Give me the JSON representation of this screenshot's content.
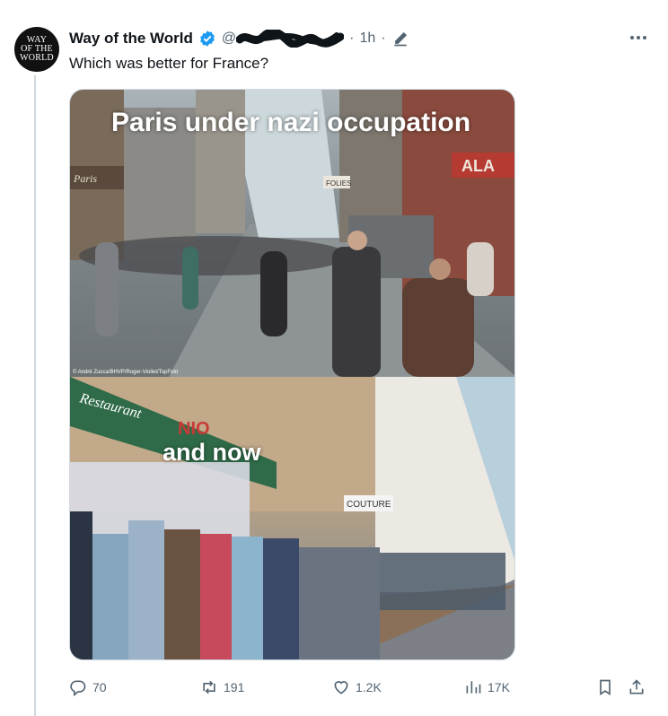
{
  "author": {
    "display_name": "Way of the World",
    "avatar_text": [
      "WAY",
      "OF THE",
      "WORLD"
    ],
    "verified": true,
    "handle_prefix": "@",
    "handle_redacted": true
  },
  "meta": {
    "separator": "·",
    "time": "1h"
  },
  "tweet": {
    "text": "Which was better for France?"
  },
  "media": {
    "top_caption": "Paris under nazi occupation",
    "top_credit": "© André Zucca/BHVP/Roger-Viollet/TopFoto",
    "bottom_caption": "and now",
    "top_signs": [
      "Paris",
      "FOLIES",
      "ALA"
    ],
    "bottom_signs": [
      "Restaurant",
      "NIO",
      "COUTURE"
    ]
  },
  "actions": {
    "replies": "70",
    "reposts": "191",
    "likes": "1.2K",
    "views": "17K"
  },
  "colors": {
    "verified": "#1d9bf0",
    "muted": "#536471",
    "text": "#0f1419"
  }
}
